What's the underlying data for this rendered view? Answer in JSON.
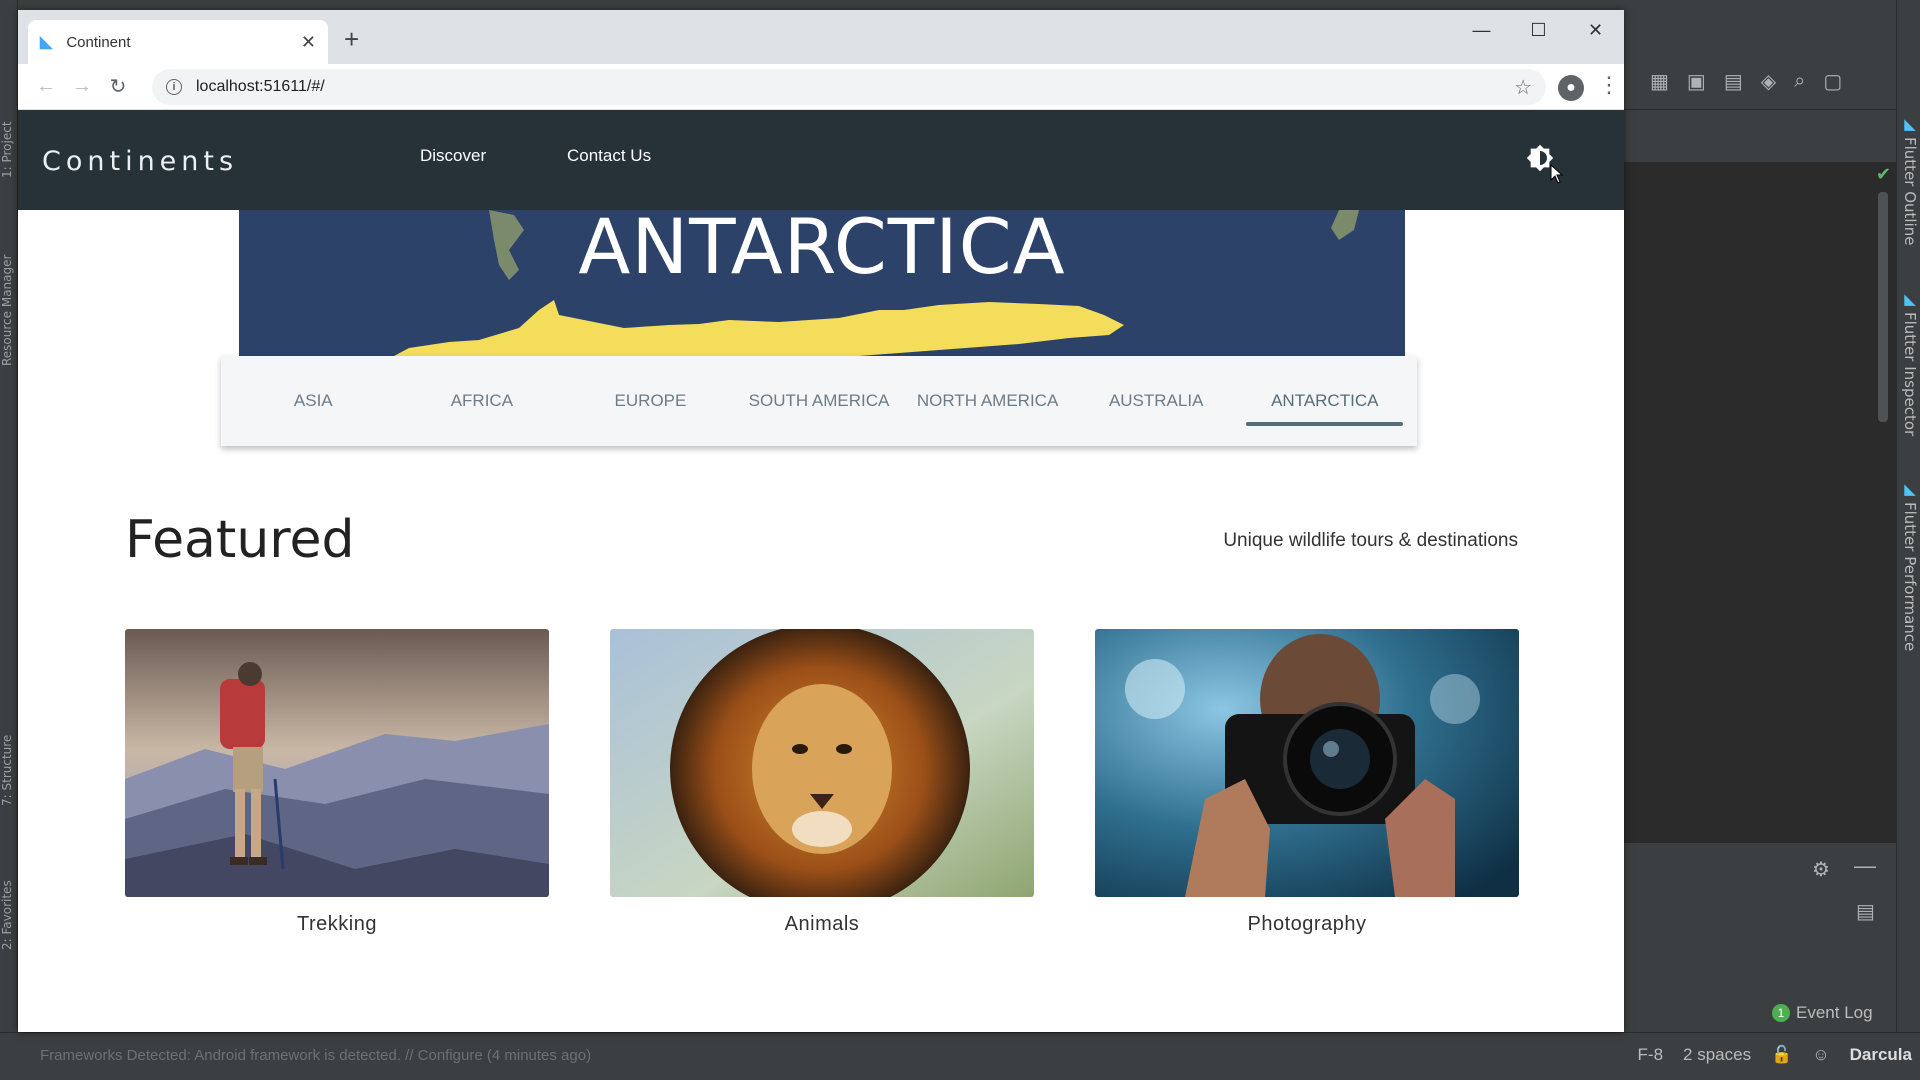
{
  "ide": {
    "left_tabs": [
      "1: Project",
      "Resource Manager",
      "7: Structure",
      "2: Favorites"
    ],
    "right_tabs": [
      "Flutter Outline",
      "Flutter Inspector",
      "Flutter Performance"
    ],
    "event_log": {
      "count": "1",
      "label": "Event Log"
    },
    "status": {
      "left": "Frameworks Detected: Android framework is detected. // Configure (4 minutes ago)",
      "encoding": "F-8",
      "indent": "2 spaces",
      "theme": "Darcula"
    }
  },
  "browser": {
    "tab_title": "Continent",
    "url": "localhost:51611/#/"
  },
  "app": {
    "brand": "Continents",
    "nav": [
      "Discover",
      "Contact Us"
    ],
    "hero_title": "ANTARCTICA",
    "continent_tabs": [
      "ASIA",
      "AFRICA",
      "EUROPE",
      "SOUTH AMERICA",
      "NORTH AMERICA",
      "AUSTRALIA",
      "ANTARCTICA"
    ],
    "active_tab": "ANTARCTICA",
    "featured": {
      "title": "Featured",
      "subtitle": "Unique wildlife tours & destinations",
      "cards": [
        {
          "caption": "Trekking"
        },
        {
          "caption": "Animals"
        },
        {
          "caption": "Photography"
        }
      ]
    }
  },
  "colors": {
    "appbar": "#263238",
    "hero_bg": "#2c4268",
    "hero_land": "#f5dd5c",
    "tab_active": "#546e7a"
  }
}
